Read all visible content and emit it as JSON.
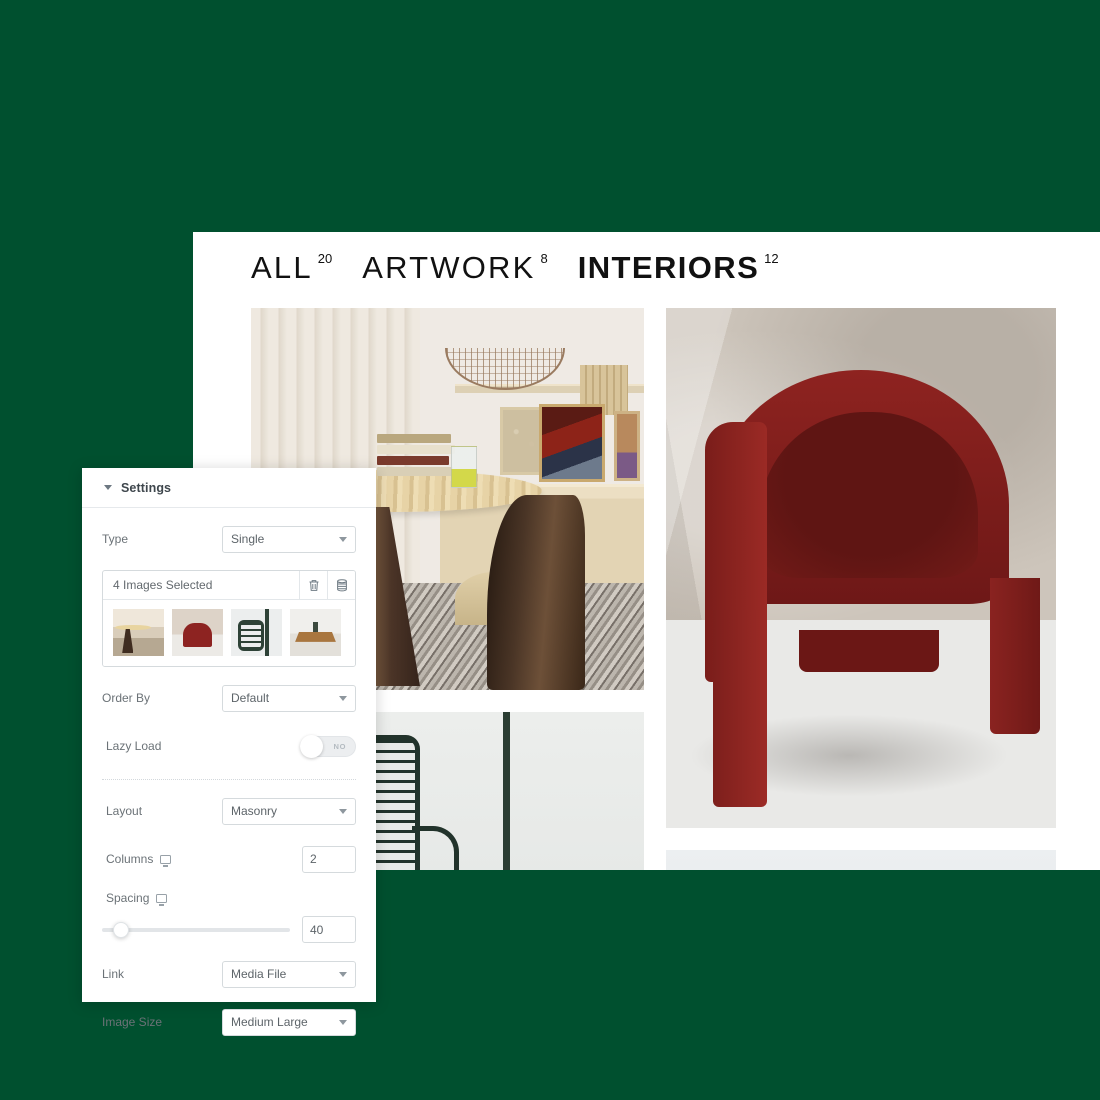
{
  "background_color": "#00502f",
  "gallery": {
    "filters": [
      {
        "label": "ALL",
        "count": "20",
        "active": false
      },
      {
        "label": "ARTWORK",
        "count": "8",
        "active": false
      },
      {
        "label": "INTERIORS",
        "count": "12",
        "active": true
      }
    ],
    "tiles": [
      {
        "name": "interior-dining-table",
        "alt": "Interior with round wooden table, stacked books and wire bowl"
      },
      {
        "name": "green-wire-chair",
        "alt": "Dark green wire mesh chair against light wall"
      },
      {
        "name": "red-velvet-armchair",
        "alt": "Dark red velvet armchair on concrete background"
      },
      {
        "name": "pale-partial-image",
        "alt": "Partially visible pale image tile"
      }
    ]
  },
  "settings": {
    "title": "Settings",
    "type": {
      "label": "Type",
      "value": "Single"
    },
    "media": {
      "selected_label": "4 Images Selected",
      "delete_icon": "trash-icon",
      "gallery_icon": "stack-icon",
      "thumbnails": [
        {
          "name": "thumb-wood-table"
        },
        {
          "name": "thumb-red-armchair"
        },
        {
          "name": "thumb-green-chair"
        },
        {
          "name": "thumb-wood-desk"
        }
      ]
    },
    "order_by": {
      "label": "Order By",
      "value": "Default"
    },
    "lazy_load": {
      "label": "Lazy Load",
      "value": "NO",
      "enabled": false
    },
    "layout": {
      "label": "Layout",
      "value": "Masonry"
    },
    "columns": {
      "label": "Columns",
      "value": "2",
      "device_icon": "monitor-icon"
    },
    "spacing": {
      "label": "Spacing",
      "value": "40",
      "device_icon": "monitor-icon",
      "percent": 10
    },
    "link": {
      "label": "Link",
      "value": "Media File"
    },
    "image_size": {
      "label": "Image Size",
      "value": "Medium Large"
    }
  }
}
